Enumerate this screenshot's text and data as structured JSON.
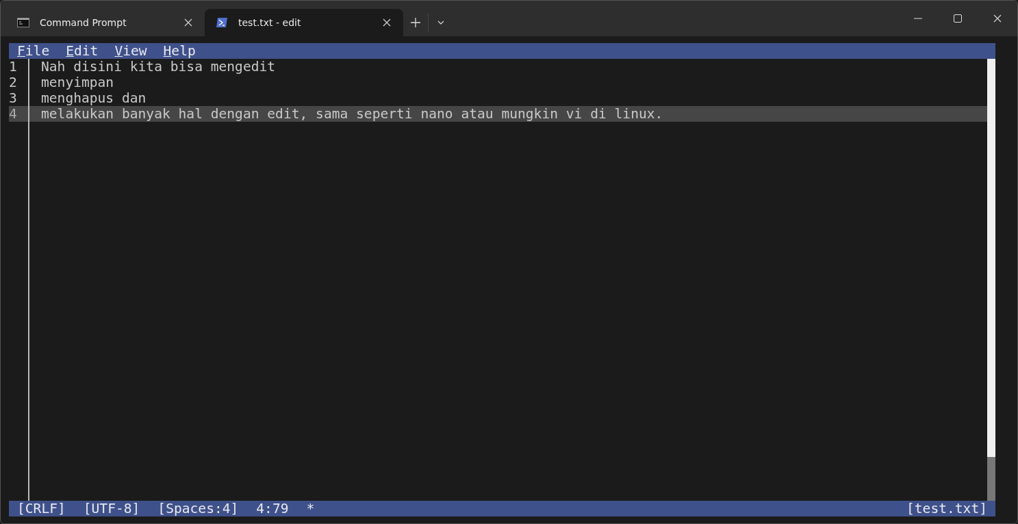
{
  "tabs": [
    {
      "label": "Command Prompt",
      "kind": "cmd",
      "selected": false
    },
    {
      "label": "test.txt - edit",
      "kind": "shell",
      "selected": true
    }
  ],
  "menu": [
    "File",
    "Edit",
    "View",
    "Help"
  ],
  "lines": [
    {
      "number": "1",
      "text": "Nah disini kita bisa mengedit",
      "current": false
    },
    {
      "number": "2",
      "text": "menyimpan",
      "current": false
    },
    {
      "number": "3",
      "text": "menghapus dan",
      "current": false
    },
    {
      "number": "4",
      "text": "melakukan banyak hal dengan edit, sama seperti nano atau mungkin vi di linux.",
      "current": true
    }
  ],
  "status_bar": {
    "items": [
      "[CRLF]",
      "[UTF-8]",
      "[Spaces:4]",
      "4:79",
      "*"
    ],
    "file": "[test.txt]"
  }
}
